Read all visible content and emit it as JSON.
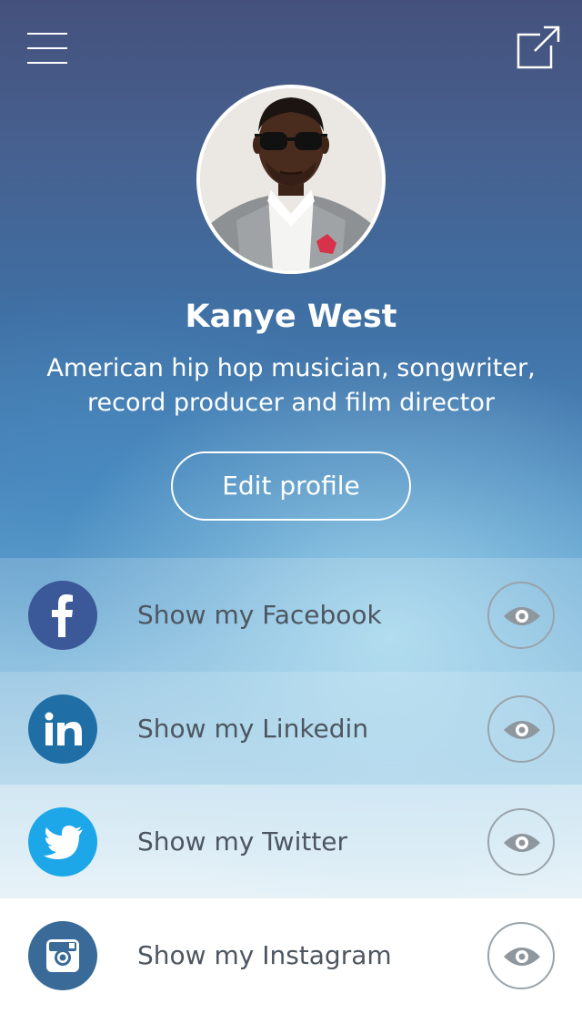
{
  "header": {
    "menu_icon": "hamburger-menu-icon",
    "share_icon": "external-share-icon"
  },
  "profile": {
    "name": "Kanye West",
    "bio": "American hip hop musician, songwriter, record producer and film director",
    "edit_label": "Edit profile"
  },
  "social": {
    "items": [
      {
        "label": "Show my Facebook",
        "icon": "facebook-icon",
        "color": "#3b5998",
        "visibility_icon": "eye-icon"
      },
      {
        "label": "Show my Linkedin",
        "icon": "linkedin-icon",
        "color": "#1f6fa6",
        "visibility_icon": "eye-icon"
      },
      {
        "label": "Show my Twitter",
        "icon": "twitter-icon",
        "color": "#1ea7e8",
        "visibility_icon": "eye-icon"
      },
      {
        "label": "Show my Instagram",
        "icon": "instagram-icon",
        "color": "#3a6a98",
        "visibility_icon": "eye-icon"
      }
    ]
  },
  "colors": {
    "header_top": "#45517c",
    "header_mid": "#3f6fa3",
    "text_dark": "#4d5660",
    "eye_gray": "#8f979e"
  }
}
